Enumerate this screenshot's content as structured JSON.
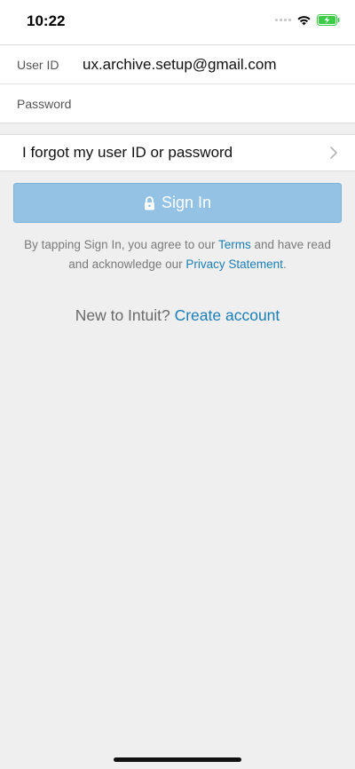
{
  "status_bar": {
    "time": "10:22"
  },
  "form": {
    "user_id_label": "User ID",
    "user_id_value": "ux.archive.setup@gmail.com",
    "password_label": "Password",
    "password_value": ""
  },
  "forgot": {
    "label": "I forgot my user ID or password"
  },
  "signin": {
    "label": "Sign In"
  },
  "terms": {
    "prefix": "By tapping Sign In, you agree to our ",
    "terms_link": "Terms",
    "middle": " and have read and acknowledge our ",
    "privacy_link": "Privacy Statement",
    "suffix": "."
  },
  "new_account": {
    "prompt": "New to Intuit? ",
    "link": "Create account"
  },
  "colors": {
    "accent_link": "#1b7fb5",
    "signin_button_disabled": "#93c2e4",
    "battery_charging": "#3ccc48"
  },
  "icons": {
    "signal": "signal-dots-icon",
    "wifi": "wifi-icon",
    "battery": "battery-charging-icon",
    "lock": "lock-icon",
    "chevron": "chevron-right-icon"
  }
}
